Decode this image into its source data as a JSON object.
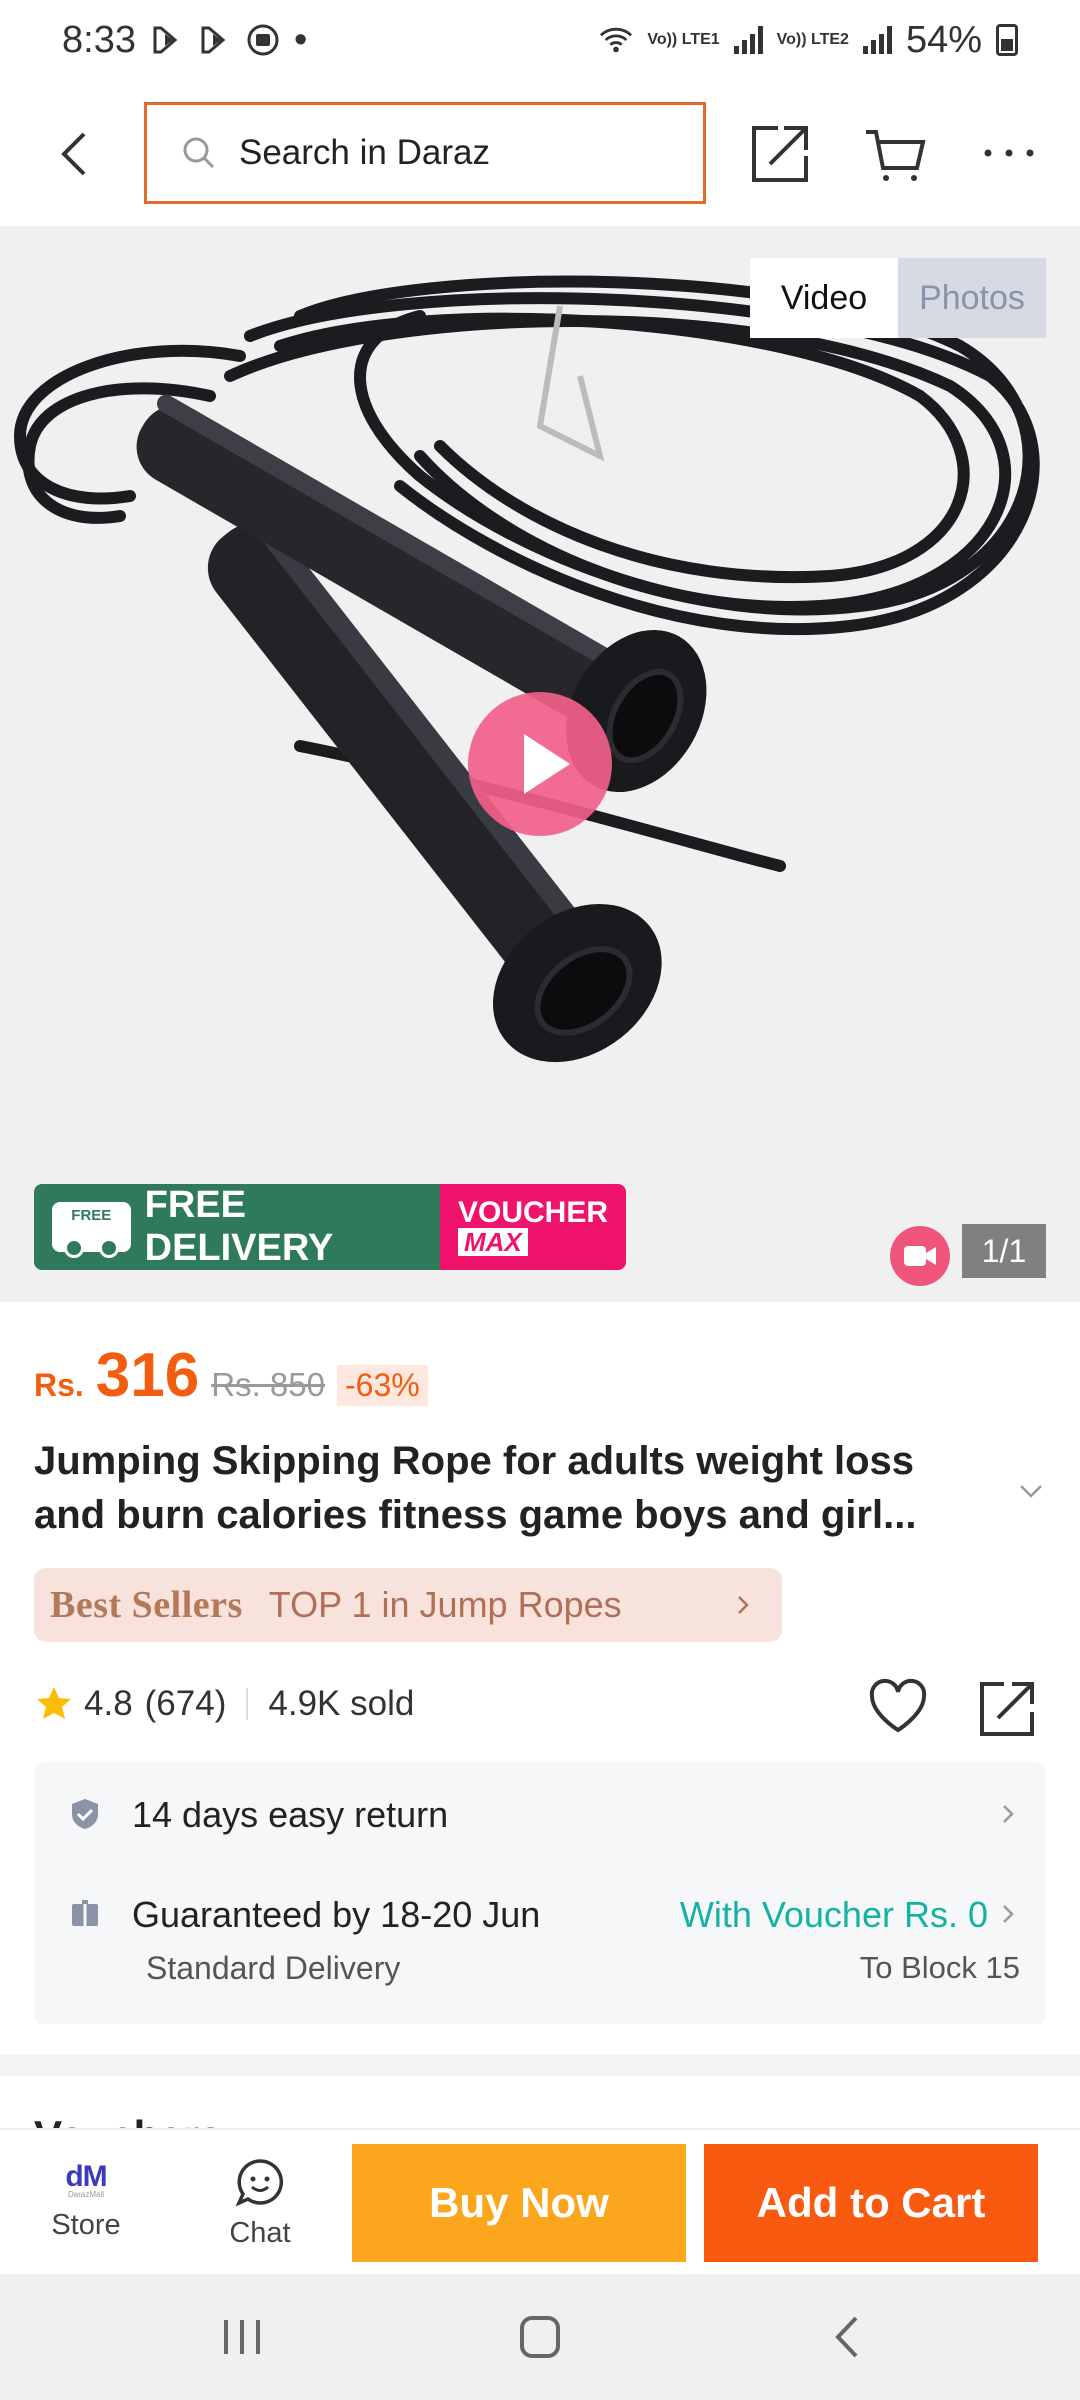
{
  "status_bar": {
    "time": "8:33",
    "dot": "•",
    "network_tags": [
      "Vo)) LTE1",
      "Vo)) LTE2"
    ],
    "battery": "54%"
  },
  "header": {
    "search_placeholder": "Search in Daraz"
  },
  "gallery": {
    "tabs": [
      "Video",
      "Photos"
    ],
    "active_tab": "Video",
    "counter": "1/1",
    "promo": {
      "free_tag": "FREE",
      "delivery": "FREE DELIVERY",
      "voucher_line1": "VOUCHER",
      "voucher_line2": "MAX"
    }
  },
  "product": {
    "currency": "Rs.",
    "price": "316",
    "original_price": "Rs. 850",
    "discount": "-63%",
    "title": "Jumping Skipping Rope for adults weight loss and burn calories fitness game boys and girl...",
    "best_seller_badge": "Best Sellers",
    "best_seller_text": "TOP 1 in Jump Ropes",
    "rating": "4.8",
    "reviews": "(674)",
    "sold": "4.9K sold"
  },
  "services": {
    "return_text": "14 days easy return",
    "delivery_text": "Guaranteed by 18-20 Jun",
    "delivery_type": "Standard Delivery",
    "voucher_text": "With Voucher Rs. 0",
    "delivery_to": "To Block 15"
  },
  "section_peek": "Vouchers",
  "actions": {
    "store_logo": "dM",
    "store_logo_sub": "DarazMall",
    "store_label": "Store",
    "chat_label": "Chat",
    "buy_now": "Buy Now",
    "add_to_cart": "Add to Cart"
  },
  "colors": {
    "accent_orange": "#f25d0f",
    "buy_now": "#fca61e",
    "add_to_cart": "#fa5a0f",
    "voucher_teal": "#13b2a2",
    "delivery_green": "#2f7a5a",
    "voucher_pink": "#f0136b"
  }
}
